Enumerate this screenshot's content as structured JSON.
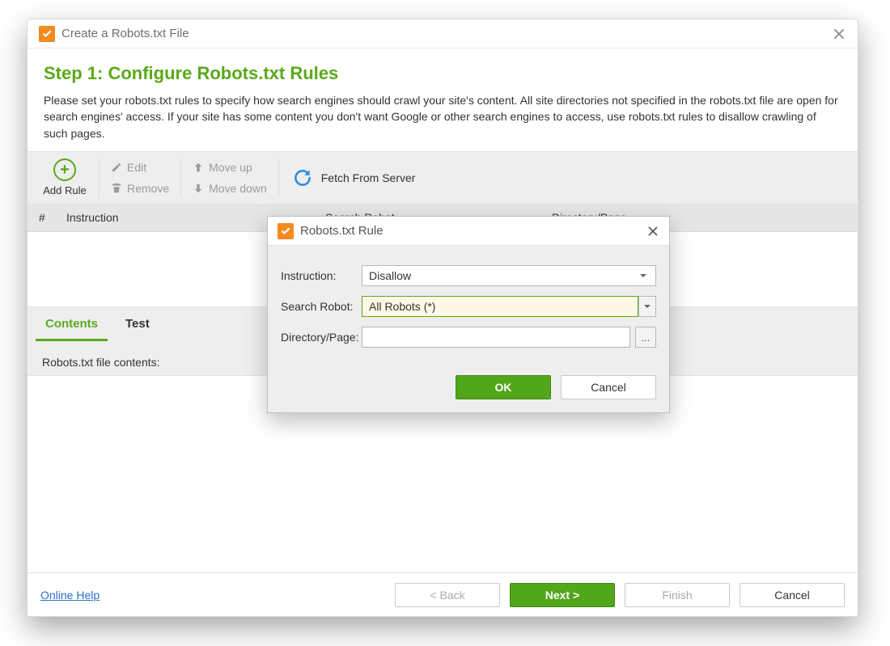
{
  "window": {
    "title": "Create a Robots.txt File"
  },
  "step": {
    "title": "Step 1: Configure Robots.txt Rules",
    "description": "Please set your robots.txt rules to specify how search engines should crawl your site's content. All site directories not specified in the robots.txt file are open for search engines' access. If your site has some content you don't want Google or other search engines to access, use robots.txt rules to disallow crawling of such pages."
  },
  "toolbar": {
    "add_rule": "Add Rule",
    "edit": "Edit",
    "remove": "Remove",
    "move_up": "Move up",
    "move_down": "Move down",
    "fetch": "Fetch From Server"
  },
  "table": {
    "columns": {
      "num": "#",
      "instruction": "Instruction",
      "robot": "Search Robot",
      "dir": "Directory/Page"
    }
  },
  "tabs": {
    "contents": "Contents",
    "test": "Test"
  },
  "contents_label": "Robots.txt file contents:",
  "footer": {
    "help": "Online Help",
    "back": "< Back",
    "next": "Next >",
    "finish": "Finish",
    "cancel": "Cancel"
  },
  "modal": {
    "title": "Robots.txt Rule",
    "labels": {
      "instruction": "Instruction:",
      "robot": "Search Robot:",
      "dir": "Directory/Page:"
    },
    "values": {
      "instruction": "Disallow",
      "robot": "All Robots (*)",
      "dir": ""
    },
    "browse": "...",
    "ok": "OK",
    "cancel": "Cancel"
  }
}
